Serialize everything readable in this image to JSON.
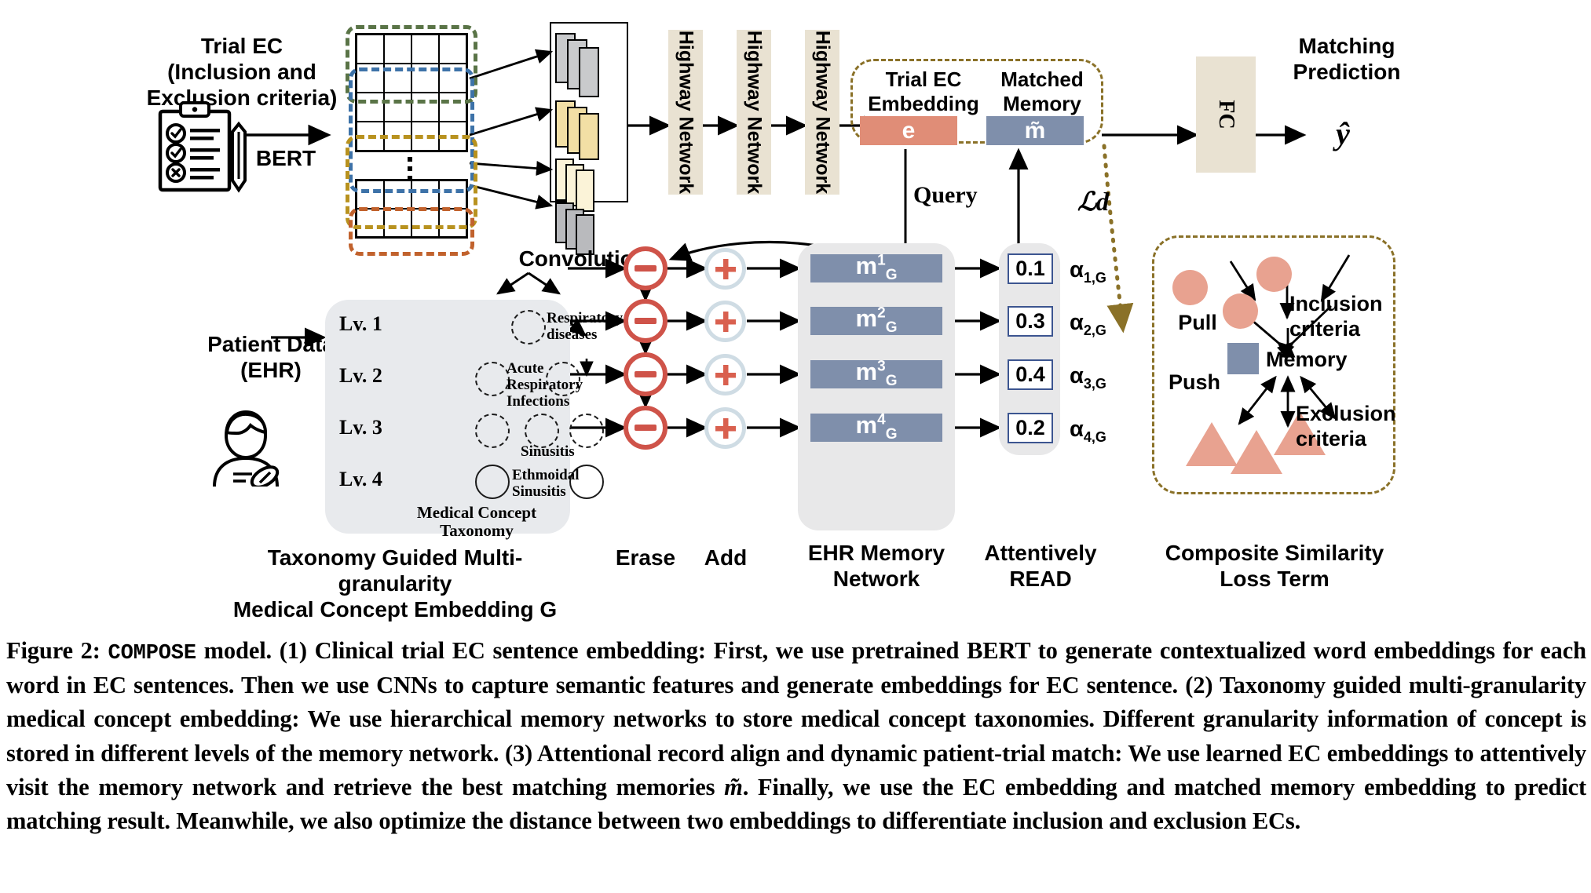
{
  "figure": {
    "labels": {
      "trial_ec": "Trial EC\n(Inclusion and\nExclusion criteria)",
      "bert": "BERT",
      "convolutions": "Convolutions",
      "highway_1": "Highway Network",
      "highway_2": "Highway Network",
      "highway_3": "Highway Network",
      "trial_ec_embedding": "Trial EC\nEmbedding",
      "matched_memory": "Matched\nMemory",
      "ec_chip": "e",
      "memory_chip": "m̃",
      "fc": "FC",
      "matching_prediction": "Matching\nPrediction",
      "y_hat": "ŷ",
      "query": "Query",
      "loss_d": "ℒd",
      "patient_data": "Patient Data\n(EHR)",
      "erase": "Erase",
      "add": "Add",
      "ehr_memory_network": "EHR Memory\nNetwork",
      "attentively_read": "Attentively\nREAD",
      "composite_loss": "Composite Similarity\nLoss Term",
      "taxonomy_caption": "Taxonomy Guided Multi-granularity\nMedical Concept Embedding G"
    },
    "taxonomy": {
      "panel_title": "Medical Concept\nTaxonomy",
      "levels": [
        "Lv. 1",
        "Lv. 2",
        "Lv. 3",
        "Lv. 4"
      ],
      "node_labels": [
        "Respiratory\ndiseases",
        "Acute\nRespiratory\nInfections",
        "Sinusitis",
        "Ethmoidal\nSinusitis"
      ]
    },
    "memory_network": {
      "slots": [
        "m",
        "m",
        "m",
        "m"
      ],
      "superscripts": [
        "1",
        "2",
        "3",
        "4"
      ],
      "subscript": "G"
    },
    "attention": {
      "values": [
        "0.1",
        "0.3",
        "0.4",
        "0.2"
      ],
      "alphas": [
        "α",
        "α",
        "α",
        "α"
      ],
      "alpha_subs": [
        "1,G",
        "2,G",
        "3,G",
        "4,G"
      ]
    },
    "loss_panel": {
      "pull": "Pull",
      "push": "Push",
      "memory": "Memory",
      "inclusion": "Inclusion\ncriteria",
      "exclusion": "Exclusion\ncriteria"
    },
    "colors": {
      "highway_fill": "#e9e2d2",
      "memory_blue": "#7f8fab",
      "ec_salmon": "#e08d77",
      "erase_red": "#cf5349",
      "add_blue": "#cfdce4",
      "attn_border": "#3c5590",
      "dash_gold": "#8a7128",
      "panel_gray": "#e8eaed",
      "shape_salmon": "#e8a290",
      "conv_gray": "#c9cacc",
      "conv_yellow_dark": "#f2dfa5",
      "conv_yellow_light": "#fbf3d8",
      "box_green": "#5a7447",
      "box_blue": "#3d72a8",
      "box_gold": "#b8921f",
      "box_orange": "#c1622d"
    }
  },
  "caption": {
    "prefix": "Figure 2:",
    "model_name": "COMPOSE",
    "text": " model. (1) Clinical trial EC sentence embedding: First, we use pretrained BERT to generate contextualized word embeddings for each word in EC sentences. Then we use CNNs to capture semantic features and generate embeddings for EC sentence. (2) Taxonomy guided multi-granularity medical concept embedding: We use hierarchical memory networks to store medical concept taxonomies. Different granularity information of concept is stored in different levels of the memory network. (3) Attentional record align and dynamic patient-trial match: We use learned EC embeddings to attentively visit the memory network and retrieve the best matching memories ",
    "symbol": "m̃",
    "text2": ". Finally, we use the EC embedding and matched memory embedding to predict matching result. Meanwhile, we also optimize the distance between two embeddings to differentiate inclusion and exclusion ECs."
  }
}
